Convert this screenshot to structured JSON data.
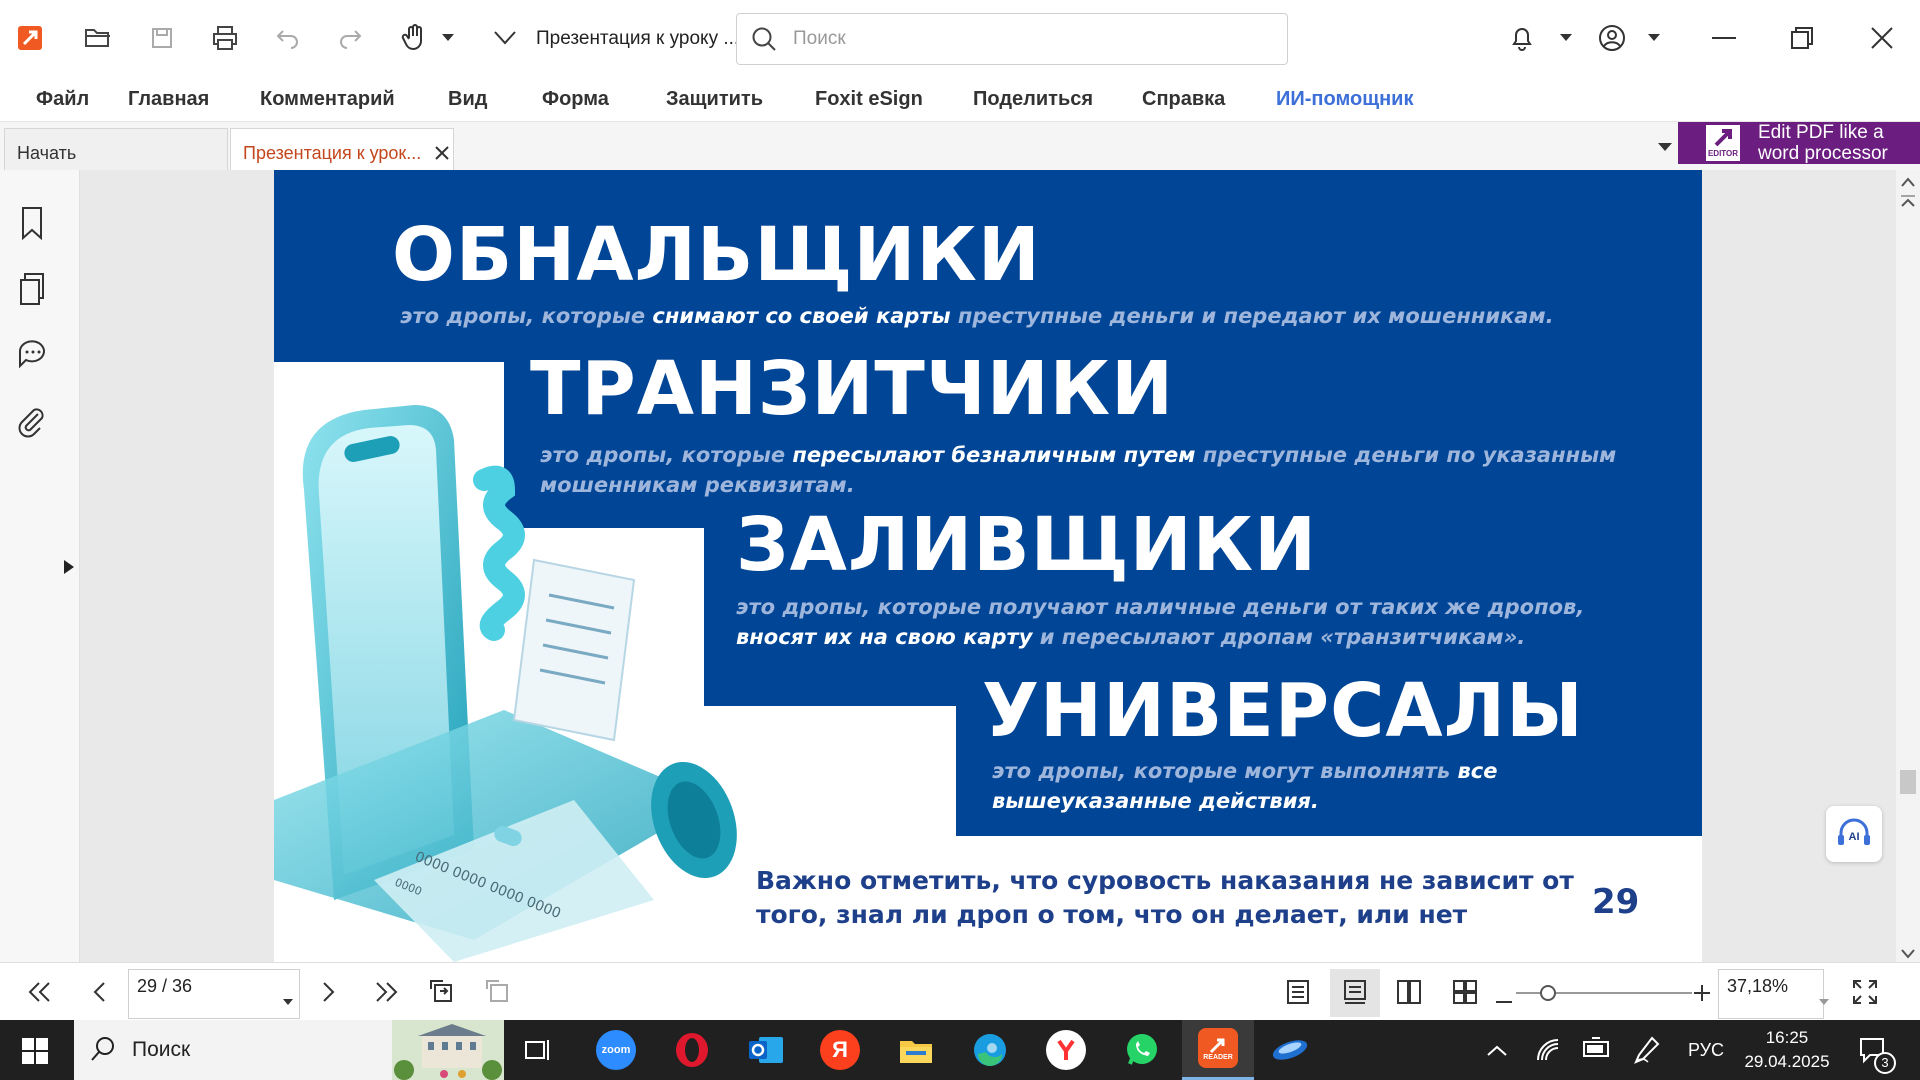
{
  "titlebar": {
    "doc_title": "Презентация к уроку ...",
    "search_placeholder": "Поиск"
  },
  "menu": [
    "Файл",
    "Главная",
    "Комментарий",
    "Вид",
    "Форма",
    "Защитить",
    "Foxit eSign",
    "Поделиться",
    "Справка",
    "ИИ-помощник"
  ],
  "tabs": {
    "start": "Начать",
    "doc": "Презентация к урок..."
  },
  "promo": {
    "line1": "Edit PDF like a",
    "line2": "word processor",
    "badge": "EDITOR"
  },
  "slide": {
    "h1": "ОБНАЛЬЩИКИ",
    "h1_sub_pre": "это дропы, которые ",
    "h1_sub_bold": "снимают со своей карты",
    "h1_sub_post": " преступные деньги и передают их мошенникам.",
    "h2": "ТРАНЗИТЧИКИ",
    "h2_sub_pre": "это дропы, которые ",
    "h2_sub_bold": "пересылают безналичным путем",
    "h2_sub_post": " преступные деньги по указанным мошенникам реквизитам.",
    "h3": "ЗАЛИВЩИКИ",
    "h3_sub_pre": "это дропы, которые получают наличные деньги от таких же дропов, ",
    "h3_sub_bold": "вносят их на свою карту",
    "h3_sub_post": " и пересылают дропам «транзитчикам».",
    "h4": "УНИВЕРСАЛЫ",
    "h4_sub_pre": "это дропы, которые могут выполнять ",
    "h4_sub_bold": "все вышеуказанные действия.",
    "note": "Важно отметить, что суровость наказания не зависит от того, знал ли дроп о том, что он делает, или нет",
    "page_number": "29",
    "card_digits": "0000 0000 0000 0000",
    "card_small": "0000"
  },
  "bottom": {
    "page_field": "29 / 36",
    "zoom": "37,18%"
  },
  "taskbar": {
    "search": "Поиск",
    "zoom_app": "zoom",
    "reader_label": "READER",
    "lang": "РУС",
    "time": "16:25",
    "date": "29.04.2025",
    "notif_count": "3",
    "yandex_letter": "Я",
    "ai_label": "AI"
  },
  "colors": {
    "brand_orange": "#f05a22",
    "slide_blue": "#004596",
    "ai_menu": "#3c6fd8",
    "promo_purple": "#6b1d80"
  }
}
